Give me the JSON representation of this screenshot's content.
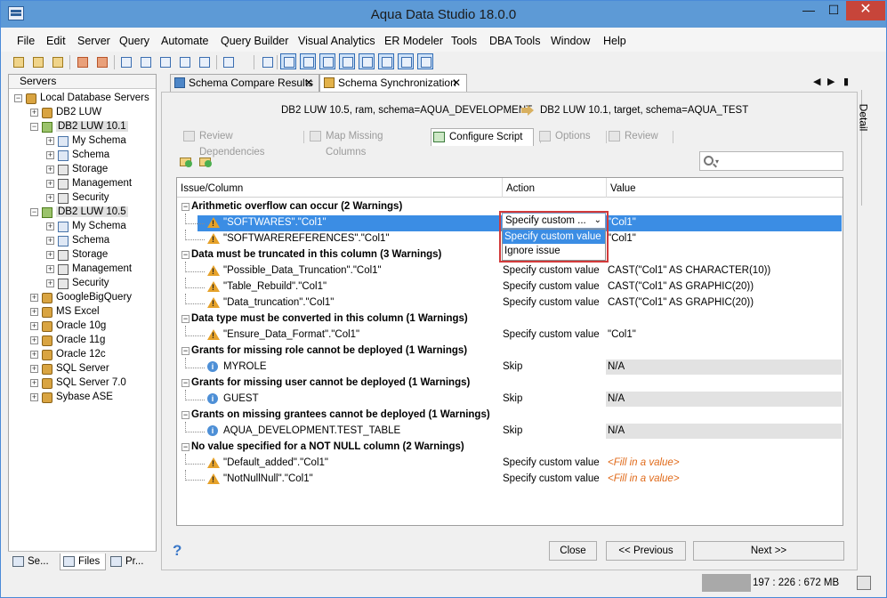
{
  "app": {
    "title": "Aqua Data Studio 18.0.0"
  },
  "window_controls": {
    "minimize": "—",
    "maximize": "☐",
    "close": "✕"
  },
  "menu": [
    "File",
    "Edit",
    "Server",
    "Query",
    "Automate",
    "Query Builder",
    "Visual Analytics",
    "ER Modeler",
    "Tools",
    "DBA Tools",
    "Window",
    "Help"
  ],
  "servers_panel": {
    "title": "Servers",
    "tree": [
      {
        "label": "Local Database Servers",
        "level": 0,
        "icon": "server-group-icon",
        "expand": "−"
      },
      {
        "label": "DB2 LUW",
        "level": 1,
        "icon": "database-icon",
        "expand": "+"
      },
      {
        "label": "DB2 LUW 10.1",
        "level": 1,
        "icon": "database-connected-icon",
        "expand": "−",
        "highlight": true
      },
      {
        "label": "My Schema",
        "level": 2,
        "icon": "schema-icon",
        "expand": "+"
      },
      {
        "label": "Schema",
        "level": 2,
        "icon": "schema-icon",
        "expand": "+"
      },
      {
        "label": "Storage",
        "level": 2,
        "icon": "storage-icon",
        "expand": "+"
      },
      {
        "label": "Management",
        "level": 2,
        "icon": "management-icon",
        "expand": "+"
      },
      {
        "label": "Security",
        "level": 2,
        "icon": "security-icon",
        "expand": "+"
      },
      {
        "label": "DB2 LUW 10.5",
        "level": 1,
        "icon": "database-connected-icon",
        "expand": "−",
        "highlight": true
      },
      {
        "label": "My Schema",
        "level": 2,
        "icon": "schema-icon",
        "expand": "+"
      },
      {
        "label": "Schema",
        "level": 2,
        "icon": "schema-icon",
        "expand": "+"
      },
      {
        "label": "Storage",
        "level": 2,
        "icon": "storage-icon",
        "expand": "+"
      },
      {
        "label": "Management",
        "level": 2,
        "icon": "management-icon",
        "expand": "+"
      },
      {
        "label": "Security",
        "level": 2,
        "icon": "security-icon",
        "expand": "+"
      },
      {
        "label": "GoogleBigQuery",
        "level": 1,
        "icon": "database-icon",
        "expand": "+"
      },
      {
        "label": "MS Excel",
        "level": 1,
        "icon": "database-icon",
        "expand": "+"
      },
      {
        "label": "Oracle 10g",
        "level": 1,
        "icon": "database-icon",
        "expand": "+"
      },
      {
        "label": "Oracle 11g",
        "level": 1,
        "icon": "database-icon",
        "expand": "+"
      },
      {
        "label": "Oracle 12c",
        "level": 1,
        "icon": "database-icon",
        "expand": "+"
      },
      {
        "label": "SQL Server",
        "level": 1,
        "icon": "database-icon",
        "expand": "+"
      },
      {
        "label": "SQL Server 7.0",
        "level": 1,
        "icon": "database-icon",
        "expand": "+"
      },
      {
        "label": "Sybase ASE",
        "level": 1,
        "icon": "database-icon",
        "expand": "+"
      }
    ],
    "bottom_tabs": [
      "Se...",
      "Files",
      "Pr..."
    ]
  },
  "editor_tabs": [
    {
      "label": "Schema Compare Results",
      "active": false,
      "close": "✕"
    },
    {
      "label": "Schema Synchronization",
      "active": true,
      "close": "✕"
    }
  ],
  "tab_nav": {
    "left": "◀",
    "right": "▶",
    "menu": "▮"
  },
  "detail_tab": "Detail",
  "sync": {
    "source": "DB2 LUW 10.5, ram,  schema=AQUA_DEVELOPMENT",
    "target": "DB2 LUW 10.1, target,  schema=AQUA_TEST",
    "wizard_tabs": [
      {
        "label": "Review Dependencies",
        "active": false
      },
      {
        "label": "Map Missing Columns",
        "active": false
      },
      {
        "label": "Configure Script",
        "active": true
      },
      {
        "label": "Options",
        "active": false
      },
      {
        "label": "Review",
        "active": false
      }
    ],
    "columns": {
      "issue": "Issue/Column",
      "action": "Action",
      "value": "Value"
    },
    "rows": [
      {
        "type": "group",
        "text": "Arithmetic overflow can occur (2 Warnings)"
      },
      {
        "type": "item",
        "icon": "warning",
        "text": "\"SOFTWARES\".\"Col1\"",
        "action": "Specify custom ...",
        "value": "\"Col1\"",
        "selected": true
      },
      {
        "type": "item",
        "icon": "warning",
        "text": "\"SOFTWAREREFERENCES\".\"Col1\"",
        "action": "",
        "value": "\"Col1\""
      },
      {
        "type": "group",
        "text": "Data must be truncated in this column (3 Warnings)"
      },
      {
        "type": "item",
        "icon": "warning",
        "text": "\"Possible_Data_Truncation\".\"Col1\"",
        "action": "Specify custom value",
        "value": "CAST(\"Col1\" AS CHARACTER(10))"
      },
      {
        "type": "item",
        "icon": "warning",
        "text": "\"Table_Rebuild\".\"Col1\"",
        "action": "Specify custom value",
        "value": "CAST(\"Col1\" AS GRAPHIC(20))"
      },
      {
        "type": "item",
        "icon": "warning",
        "text": "\"Data_truncation\".\"Col1\"",
        "action": "Specify custom value",
        "value": "CAST(\"Col1\" AS GRAPHIC(20))"
      },
      {
        "type": "group",
        "text": "Data type must be converted in this column (1 Warnings)"
      },
      {
        "type": "item",
        "icon": "warning",
        "text": "\"Ensure_Data_Format\".\"Col1\"",
        "action": "Specify custom value",
        "value": "\"Col1\""
      },
      {
        "type": "group",
        "text": "Grants for missing role cannot be deployed (1 Warnings)"
      },
      {
        "type": "item",
        "icon": "info",
        "text": "MYROLE",
        "action": "Skip",
        "value": "N/A",
        "na": true
      },
      {
        "type": "group",
        "text": "Grants for missing user cannot be deployed (1 Warnings)"
      },
      {
        "type": "item",
        "icon": "info",
        "text": "GUEST",
        "action": "Skip",
        "value": "N/A",
        "na": true
      },
      {
        "type": "group",
        "text": "Grants on missing grantees cannot be deployed (1 Warnings)"
      },
      {
        "type": "item",
        "icon": "info",
        "text": "AQUA_DEVELOPMENT.TEST_TABLE",
        "action": "Skip",
        "value": "N/A",
        "na": true
      },
      {
        "type": "group",
        "text": "No value specified for a NOT NULL column (2 Warnings)"
      },
      {
        "type": "item",
        "icon": "warning",
        "text": "\"Default_added\".\"Col1\"",
        "action": "Specify custom value",
        "value": "<Fill in a value>",
        "fill": true
      },
      {
        "type": "item",
        "icon": "warning",
        "text": "\"NotNullNull\".\"Col1\"",
        "action": "Specify custom value",
        "value": "<Fill in a value>",
        "fill": true
      }
    ],
    "dropdown": {
      "selected": "Specify custom ...",
      "arrow": "⌄",
      "options": [
        "Specify custom value",
        "Ignore issue"
      ],
      "highlighted": 0
    },
    "buttons": {
      "help": "?",
      "close": "Close",
      "previous": "<< Previous",
      "next": "Next >>"
    }
  },
  "status": {
    "memory": "197 : 226 : 672 MB",
    "memory_used_fraction": 0.29
  },
  "colors": {
    "accent": "#3b8de4",
    "titlebar": "#5d9ad6",
    "warning": "#e6a22a",
    "fill_value": "#e06a1a",
    "dropdown_border": "#d23a3a"
  }
}
